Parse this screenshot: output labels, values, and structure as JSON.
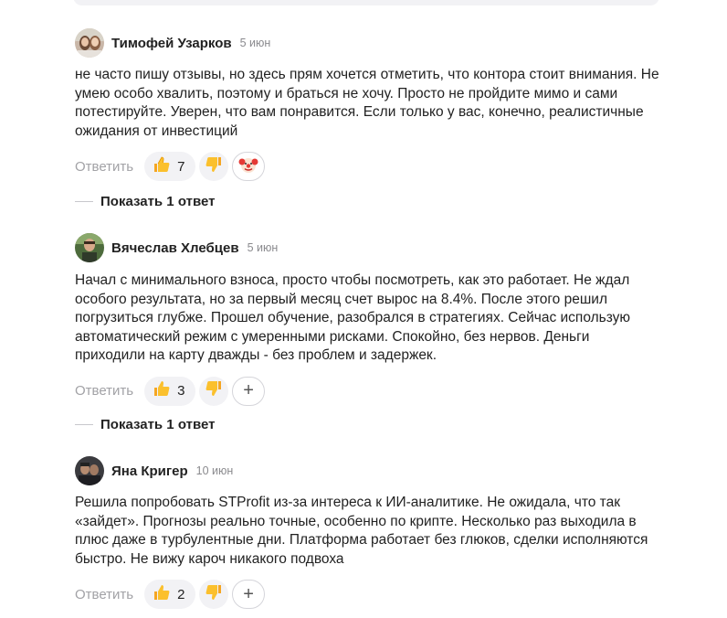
{
  "comments": [
    {
      "author": "Тимофей Узарков",
      "date": "5 июн",
      "text": "не часто пишу отзывы, но здесь прям хочется отметить, что контора стоит внимания. Не умею особо хвалить, поэтому и браться не хочу. Просто не пройдите мимо и сами потестируйте. Уверен, что вам понравится. Если только у вас, конечно, реалистичные ожидания от инвестиций",
      "reply_label": "Ответить",
      "likes": "7",
      "show_replies": "Показать 1 ответ"
    },
    {
      "author": "Вячеслав Хлебцев",
      "date": "5 июн",
      "text": "Начал с минимального взноса, просто чтобы посмотреть, как это работает. Не ждал особого результата, но за первый месяц счет вырос на 8.4%. После этого решил погрузиться глубже. Прошел обучение, разобрался в стратегиях. Сейчас использую автоматический режим с умеренными рисками. Спокойно, без нервов. Деньги приходили на карту дважды - без проблем и задержек.",
      "reply_label": "Ответить",
      "likes": "3",
      "show_replies": "Показать 1 ответ"
    },
    {
      "author": "Яна Кригер",
      "date": "10 июн",
      "text": "Решила попробовать STProfit из-за интереса к ИИ-аналитике. Не ожидала, что так «зайдет». Прогнозы реально точные, особенно по крипте. Несколько раз выходила в плюс даже в турбулентные дни. Платформа работает без глюков, сделки исполняются быстро. Не вижу кароч никакого подвоха",
      "reply_label": "Ответить",
      "likes": "2"
    }
  ],
  "icons": {
    "like": "thumbs-up-icon",
    "dislike": "thumbs-down-icon",
    "clown": "clown-face-icon",
    "add": "plus-icon"
  },
  "add_reaction_symbol": "+"
}
